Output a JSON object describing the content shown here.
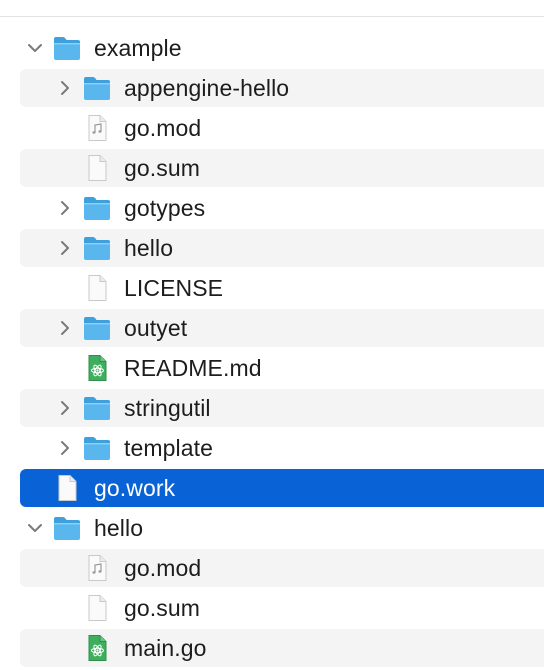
{
  "tree": [
    {
      "label": "example",
      "type": "folder",
      "depth": 0,
      "expandable": true,
      "expanded": true,
      "selected": false
    },
    {
      "label": "appengine-hello",
      "type": "folder",
      "depth": 1,
      "expandable": true,
      "expanded": false,
      "selected": false
    },
    {
      "label": "go.mod",
      "type": "audio-file",
      "depth": 1,
      "expandable": false,
      "expanded": false,
      "selected": false
    },
    {
      "label": "go.sum",
      "type": "file",
      "depth": 1,
      "expandable": false,
      "expanded": false,
      "selected": false
    },
    {
      "label": "gotypes",
      "type": "folder",
      "depth": 1,
      "expandable": true,
      "expanded": false,
      "selected": false
    },
    {
      "label": "hello",
      "type": "folder",
      "depth": 1,
      "expandable": true,
      "expanded": false,
      "selected": false
    },
    {
      "label": "LICENSE",
      "type": "file",
      "depth": 1,
      "expandable": false,
      "expanded": false,
      "selected": false
    },
    {
      "label": "outyet",
      "type": "folder",
      "depth": 1,
      "expandable": true,
      "expanded": false,
      "selected": false
    },
    {
      "label": "README.md",
      "type": "atom-file",
      "depth": 1,
      "expandable": false,
      "expanded": false,
      "selected": false
    },
    {
      "label": "stringutil",
      "type": "folder",
      "depth": 1,
      "expandable": true,
      "expanded": false,
      "selected": false
    },
    {
      "label": "template",
      "type": "folder",
      "depth": 1,
      "expandable": true,
      "expanded": false,
      "selected": false
    },
    {
      "label": "go.work",
      "type": "file",
      "depth": 0,
      "expandable": false,
      "expanded": false,
      "selected": true
    },
    {
      "label": "hello",
      "type": "folder",
      "depth": 0,
      "expandable": true,
      "expanded": true,
      "selected": false
    },
    {
      "label": "go.mod",
      "type": "audio-file",
      "depth": 1,
      "expandable": false,
      "expanded": false,
      "selected": false
    },
    {
      "label": "go.sum",
      "type": "file",
      "depth": 1,
      "expandable": false,
      "expanded": false,
      "selected": false
    },
    {
      "label": "main.go",
      "type": "atom-file",
      "depth": 1,
      "expandable": false,
      "expanded": false,
      "selected": false
    }
  ],
  "colors": {
    "selection": "#0a63d6",
    "alt_row": "#f4f4f4",
    "folder_body": "#5ab7ee",
    "folder_tab": "#3ea0dd",
    "atom_doc": "#3fae5e"
  }
}
